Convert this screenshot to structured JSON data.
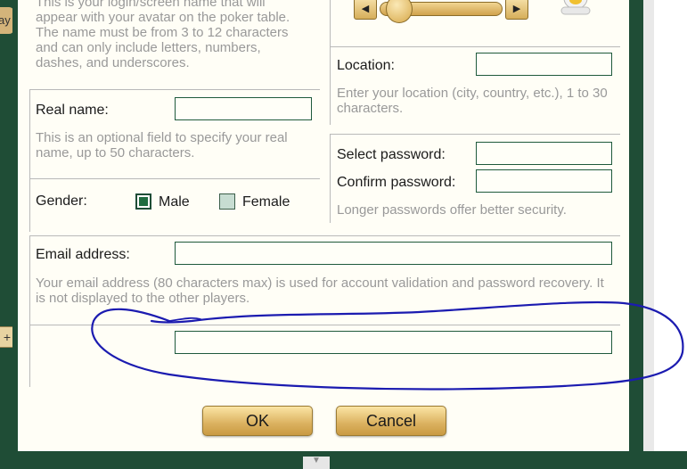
{
  "background": {
    "left_tab_text": "ay",
    "plus_symbol": "+"
  },
  "screen_name": {
    "help": "This is your login/screen name that will appear with your avatar on the poker table. The name must be from 3 to 12 characters and can only include letters, numbers, dashes, and underscores."
  },
  "real_name": {
    "label": "Real name:",
    "value": "",
    "help": "This is an optional field to specify your real name, up to 50 characters."
  },
  "gender": {
    "label": "Gender:",
    "options": [
      {
        "label": "Male",
        "checked": true
      },
      {
        "label": "Female",
        "checked": false
      }
    ]
  },
  "location": {
    "label": "Location:",
    "value": "",
    "help": "Enter your location (city, country, etc.), 1 to 30 characters."
  },
  "password": {
    "select_label": "Select password:",
    "confirm_label": "Confirm password:",
    "help": "Longer passwords offer better security."
  },
  "email": {
    "label": "Email address:",
    "value": "",
    "help": "Your email address (80 characters max) is used for account validation and password recovery. It is not displayed to the other players."
  },
  "extra_field": {
    "value": ""
  },
  "avatar_slider": {
    "prev_symbol": "◀",
    "next_symbol": "▶"
  },
  "buttons": {
    "ok": "OK",
    "cancel": "Cancel"
  },
  "colors": {
    "frame_green": "#1f4d36",
    "panel_bg": "#fffef6",
    "button_gold": "#dbb15f",
    "scribble_blue": "#1b1bb0"
  }
}
